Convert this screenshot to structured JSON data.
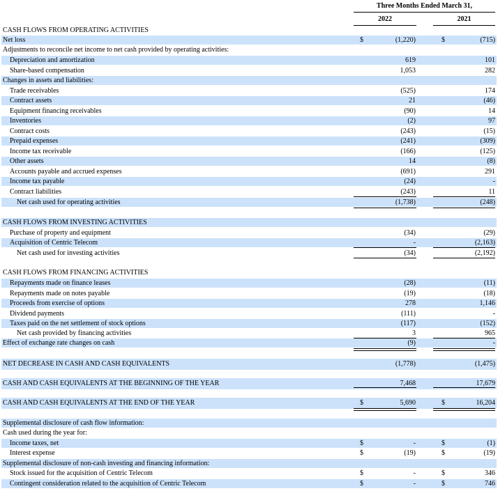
{
  "header": {
    "period": "Three Months Ended March 31,",
    "col_2022": "2022",
    "col_2021": "2021"
  },
  "rows": [
    {
      "label": "CASH FLOWS FROM OPERATING ACTIVITIES",
      "indent": 0,
      "shade": false,
      "v22": "",
      "v21": "",
      "dollar": false
    },
    {
      "label": "Net loss",
      "indent": 0,
      "shade": true,
      "v22": "(1,220)",
      "v21": "(715)",
      "dollar": true
    },
    {
      "label": "Adjustments to reconcile net income to net cash provided by operating activities:",
      "indent": 0,
      "shade": false,
      "v22": "",
      "v21": "",
      "dollar": false
    },
    {
      "label": "Depreciation and amortization",
      "indent": 1,
      "shade": true,
      "v22": "619",
      "v21": "101",
      "dollar": false
    },
    {
      "label": "Share-based compensation",
      "indent": 1,
      "shade": false,
      "v22": "1,053",
      "v21": "282",
      "dollar": false
    },
    {
      "label": "Changes in assets and liabilities:",
      "indent": 0,
      "shade": true,
      "v22": "",
      "v21": "",
      "dollar": false
    },
    {
      "label": "Trade receivables",
      "indent": 1,
      "shade": false,
      "v22": "(525)",
      "v21": "174",
      "dollar": false
    },
    {
      "label": "Contract assets",
      "indent": 1,
      "shade": true,
      "v22": "21",
      "v21": "(46)",
      "dollar": false
    },
    {
      "label": "Equipment financing receivables",
      "indent": 1,
      "shade": false,
      "v22": "(90)",
      "v21": "14",
      "dollar": false
    },
    {
      "label": "Inventories",
      "indent": 1,
      "shade": true,
      "v22": "(2)",
      "v21": "97",
      "dollar": false
    },
    {
      "label": "Contract costs",
      "indent": 1,
      "shade": false,
      "v22": "(243)",
      "v21": "(15)",
      "dollar": false
    },
    {
      "label": "Prepaid expenses",
      "indent": 1,
      "shade": true,
      "v22": "(241)",
      "v21": "(309)",
      "dollar": false
    },
    {
      "label": "Income tax receivable",
      "indent": 1,
      "shade": false,
      "v22": "(166)",
      "v21": "(125)",
      "dollar": false
    },
    {
      "label": "Other assets",
      "indent": 1,
      "shade": true,
      "v22": "14",
      "v21": "(8)",
      "dollar": false
    },
    {
      "label": "Accounts payable and accrued expenses",
      "indent": 1,
      "shade": false,
      "v22": "(691)",
      "v21": "291",
      "dollar": false
    },
    {
      "label": "Income tax payable",
      "indent": 1,
      "shade": true,
      "v22": "(24)",
      "v21": "-",
      "dollar": false
    },
    {
      "label": "Contract liabilities",
      "indent": 1,
      "shade": false,
      "v22": "(243)",
      "v21": "11",
      "dollar": false
    },
    {
      "label": "Net cash used for operating activities",
      "indent": 2,
      "shade": true,
      "v22": "(1,738)",
      "v21": "(248)",
      "dollar": false
    },
    {
      "label": "CASH FLOWS FROM INVESTING ACTIVITIES",
      "indent": 0,
      "shade": true,
      "v22": "",
      "v21": "",
      "dollar": false
    },
    {
      "label": "Purchase of property and equipment",
      "indent": 1,
      "shade": false,
      "v22": "(34)",
      "v21": "(29)",
      "dollar": false
    },
    {
      "label": "Acquisition of Centric Telecom",
      "indent": 1,
      "shade": true,
      "v22": "-",
      "v21": "(2,163)",
      "dollar": false
    },
    {
      "label": "Net cash used for investing activities",
      "indent": 2,
      "shade": false,
      "v22": "(34)",
      "v21": "(2,192)",
      "dollar": false
    },
    {
      "label": "CASH FLOWS FROM FINANCING ACTIVITIES",
      "indent": 0,
      "shade": false,
      "v22": "",
      "v21": "",
      "dollar": false
    },
    {
      "label": "Repayments made on finance leases",
      "indent": 1,
      "shade": true,
      "v22": "(28)",
      "v21": "(11)",
      "dollar": false
    },
    {
      "label": "Repayments made on notes payable",
      "indent": 1,
      "shade": false,
      "v22": "(19)",
      "v21": "(18)",
      "dollar": false
    },
    {
      "label": "Proceeds from exercise of options",
      "indent": 1,
      "shade": true,
      "v22": "278",
      "v21": "1,146",
      "dollar": false
    },
    {
      "label": "Dividend payments",
      "indent": 1,
      "shade": false,
      "v22": "(111)",
      "v21": "-",
      "dollar": false
    },
    {
      "label": "Taxes paid on the net settlement of stock options",
      "indent": 1,
      "shade": true,
      "v22": "(117)",
      "v21": "(152)",
      "dollar": false
    },
    {
      "label": "Net cash provided by financing activities",
      "indent": 2,
      "shade": false,
      "v22": "3",
      "v21": "965",
      "dollar": false
    },
    {
      "label": "Effect of exchange rate changes on cash",
      "indent": 0,
      "shade": true,
      "v22": "(9)",
      "v21": "-",
      "dollar": false
    },
    {
      "label": "NET DECREASE IN CASH AND CASH EQUIVALENTS",
      "indent": 0,
      "shade": true,
      "v22": "(1,778)",
      "v21": "(1,475)",
      "dollar": false
    },
    {
      "label": "CASH AND CASH EQUIVALENTS AT THE BEGINNING OF THE YEAR",
      "indent": 0,
      "shade": true,
      "v22": "7,468",
      "v21": "17,679",
      "dollar": false
    },
    {
      "label": "CASH AND CASH EQUIVALENTS AT THE END OF THE YEAR",
      "indent": 0,
      "shade": true,
      "v22": "5,690",
      "v21": "16,204",
      "dollar": true
    },
    {
      "label": "Supplemental disclosure of cash flow information:",
      "indent": 0,
      "shade": true,
      "v22": "",
      "v21": "",
      "dollar": false
    },
    {
      "label": "Cash used during the year for:",
      "indent": 0,
      "shade": false,
      "v22": "",
      "v21": "",
      "dollar": false
    },
    {
      "label": "Income taxes, net",
      "indent": 1,
      "shade": true,
      "v22": "-",
      "v21": "(1)",
      "dollar": true
    },
    {
      "label": "Interest expense",
      "indent": 1,
      "shade": false,
      "v22": "(19)",
      "v21": "(19)",
      "dollar": true
    },
    {
      "label": "Supplemental disclosure of non-cash investing and financing information:",
      "indent": 0,
      "shade": true,
      "v22": "",
      "v21": "",
      "dollar": false
    },
    {
      "label": "Stock issued for the acquisition of Centric Telecom",
      "indent": 1,
      "shade": false,
      "v22": "-",
      "v21": "346",
      "dollar": true
    },
    {
      "label": "Contingent consideration related to the acquisition of Centric Telecom",
      "indent": 1,
      "shade": true,
      "v22": "-",
      "v21": "746",
      "dollar": true
    }
  ],
  "currency_symbol": "$"
}
